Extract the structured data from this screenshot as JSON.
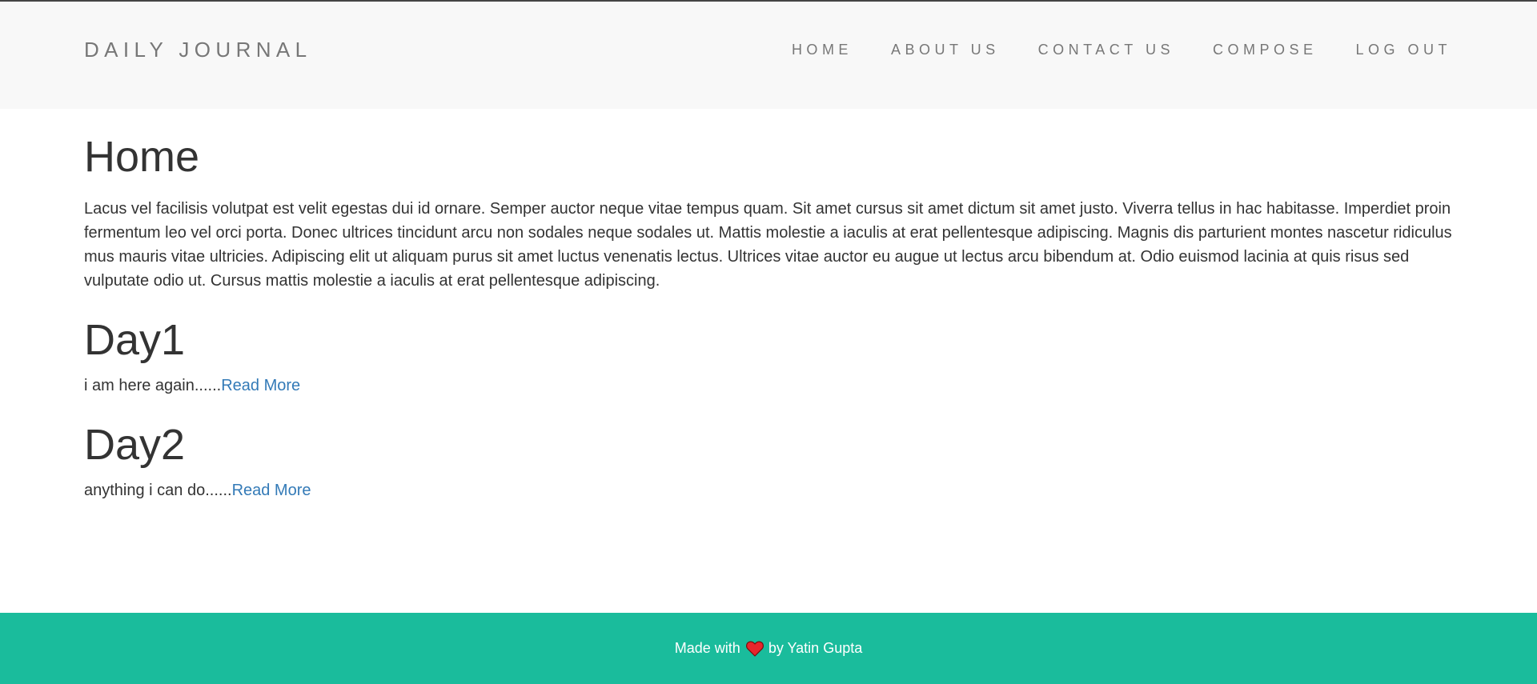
{
  "brand": "DAILY JOURNAL",
  "nav": {
    "home": "HOME",
    "about": "ABOUT US",
    "contact": "CONTACT US",
    "compose": "COMPOSE",
    "logout": "LOG OUT"
  },
  "page": {
    "title": "Home",
    "intro": "Lacus vel facilisis volutpat est velit egestas dui id ornare. Semper auctor neque vitae tempus quam. Sit amet cursus sit amet dictum sit amet justo. Viverra tellus in hac habitasse. Imperdiet proin fermentum leo vel orci porta. Donec ultrices tincidunt arcu non sodales neque sodales ut. Mattis molestie a iaculis at erat pellentesque adipiscing. Magnis dis parturient montes nascetur ridiculus mus mauris vitae ultricies. Adipiscing elit ut aliquam purus sit amet luctus venenatis lectus. Ultrices vitae auctor eu augue ut lectus arcu bibendum at. Odio euismod lacinia at quis risus sed vulputate odio ut. Cursus mattis molestie a iaculis at erat pellentesque adipiscing."
  },
  "posts": [
    {
      "title": "Day1",
      "excerpt": "i am here again......",
      "link": "Read More"
    },
    {
      "title": "Day2",
      "excerpt": "anything i can do......",
      "link": "Read More"
    }
  ],
  "footer": {
    "prefix": "Made with",
    "suffix": "by Yatin Gupta",
    "heart_icon": "heart-icon"
  },
  "colors": {
    "navbar_bg": "#f8f8f8",
    "footer_bg": "#1abc9c",
    "link": "#337ab7",
    "heart": "#e8262c"
  }
}
